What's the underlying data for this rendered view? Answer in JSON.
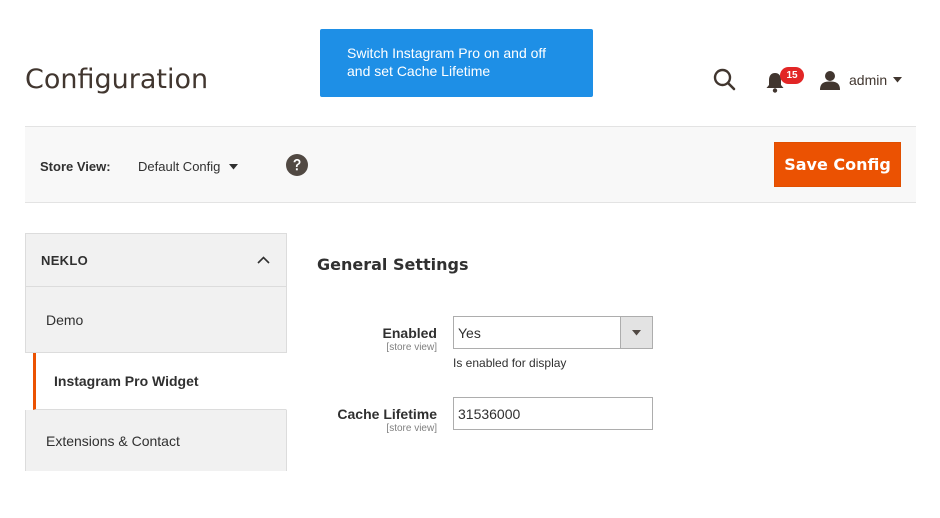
{
  "tooltip": {
    "text": "Switch Instagram Pro on and off and set Cache Lifetime"
  },
  "page": {
    "title": "Configuration"
  },
  "header": {
    "notifications_count": "15",
    "user_name": "admin"
  },
  "toolbar": {
    "store_view_label": "Store View:",
    "store_view_value": "Default Config",
    "save_label": "Save Config"
  },
  "sidebar": {
    "group_title": "NEKLO",
    "items": [
      {
        "label": "Demo"
      },
      {
        "label": "Instagram Pro Widget"
      },
      {
        "label": "Extensions & Contact"
      }
    ]
  },
  "section": {
    "title": "General Settings",
    "fields": {
      "enabled": {
        "label": "Enabled",
        "scope": "[store view]",
        "value": "Yes",
        "note": "Is enabled for display"
      },
      "cache_lifetime": {
        "label": "Cache Lifetime",
        "scope": "[store view]",
        "value": "31536000"
      }
    }
  },
  "colors": {
    "accent": "#eb5202",
    "tooltip_bg": "#1e8fe6",
    "badge": "#e22626"
  }
}
